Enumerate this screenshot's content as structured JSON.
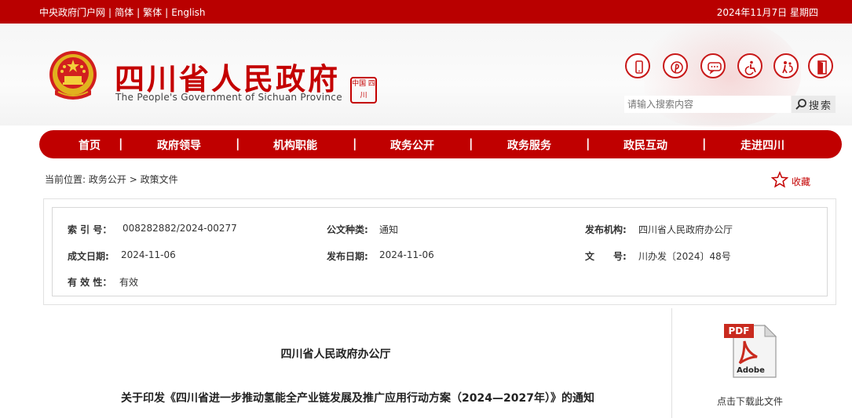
{
  "topbar": {
    "links": [
      "中央政府门户网",
      "简体",
      "繁体",
      "English"
    ],
    "separator": "|",
    "date": "2024年11月7日 星期四"
  },
  "header": {
    "title": "四川省人民政府",
    "subtitle": "The People's Government of Sichuan Province",
    "seal_text": "中国 四川",
    "tools": [
      "phone-icon",
      "weibo-icon",
      "wechat-icon",
      "accessibility-icon",
      "elder-care-icon",
      "exit-icon"
    ],
    "search": {
      "placeholder": "请输入搜索内容",
      "button": "搜索"
    }
  },
  "nav": {
    "items": [
      "首页",
      "政府领导",
      "机构职能",
      "政务公开",
      "政务服务",
      "政民互动",
      "走进四川"
    ],
    "separator": "|"
  },
  "breadcrumb": {
    "prefix": "当前位置:",
    "path": [
      "政务公开",
      "政策文件"
    ],
    "arrow": ">"
  },
  "favorite": {
    "label": "收藏"
  },
  "meta": {
    "index_label": "索 引 号：",
    "index_value": "008282882/2024-00277",
    "type_label": "公文种类:",
    "type_value": "通知",
    "org_label": "发布机构:",
    "org_value": "四川省人民政府办公厅",
    "created_label": "成文日期:",
    "created_value": "2024-11-06",
    "published_label": "发布日期:",
    "published_value": "2024-11-06",
    "docno_label": "文　　号:",
    "docno_value": "川办发〔2024〕48号",
    "validity_label": "有 效 性：",
    "validity_value": "有效"
  },
  "document": {
    "issuer": "四川省人民政府办公厅",
    "title": "关于印发《四川省进一步推动氢能全产业链发展及推广应用行动方案（2024—2027年）》的通知"
  },
  "download": {
    "pdf_badge": "PDF",
    "adobe_label": "Adobe",
    "text": "点击下载此文件"
  },
  "colors": {
    "brand_red": "#c00000",
    "topbar_red": "#b90000"
  }
}
